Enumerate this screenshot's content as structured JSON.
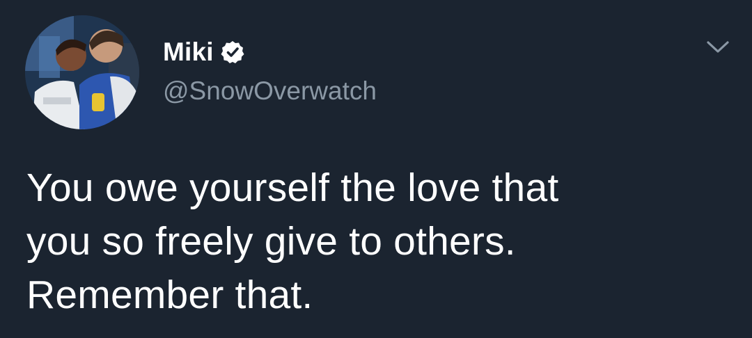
{
  "tweet": {
    "author": {
      "display_name": "Miki",
      "handle": "@SnowOverwatch",
      "verified": true,
      "avatar_icon": "profile-photo"
    },
    "text_lines": [
      "You owe yourself the love that",
      "you so freely give to others.",
      "Remember that."
    ],
    "menu_icon": "chevron-down-icon"
  },
  "colors": {
    "background": "#1b2430",
    "text": "#ffffff",
    "secondary_text": "#8b98a5"
  }
}
